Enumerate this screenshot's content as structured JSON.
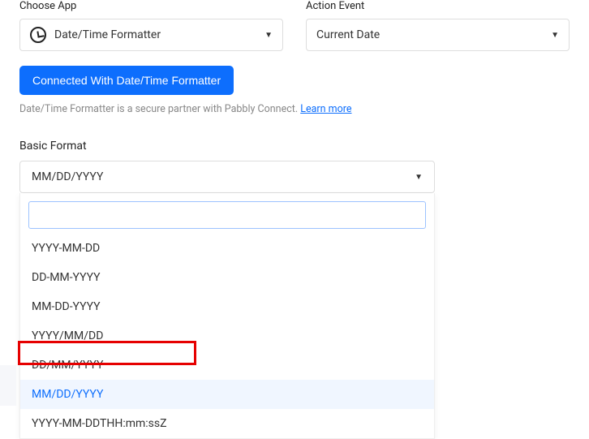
{
  "top": {
    "choose_app_label": "Choose App",
    "choose_app_value": "Date/Time Formatter",
    "action_event_label": "Action Event",
    "action_event_value": "Current Date"
  },
  "button": {
    "connected_label": "Connected With Date/Time Formatter"
  },
  "helper": {
    "text_prefix": "Date/Time Formatter is a secure partner with Pabbly Connect. ",
    "learn_more": "Learn more"
  },
  "format": {
    "label": "Basic Format",
    "selected_value": "MM/DD/YYYY",
    "search_placeholder": "",
    "options": [
      "YYYY-MM-DD",
      "DD-MM-YYYY",
      "MM-DD-YYYY",
      "YYYY/MM/DD",
      "DD/MM/YYYY",
      "MM/DD/YYYY",
      "YYYY-MM-DDTHH:mm:ssZ"
    ],
    "selected_index": 5
  },
  "caret_glyph": "▼"
}
